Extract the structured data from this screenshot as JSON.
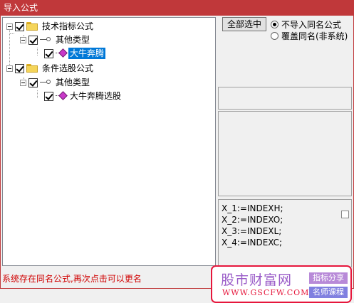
{
  "window": {
    "title": "导入公式"
  },
  "tree": {
    "nodes": [
      {
        "label": "技术指标公式"
      },
      {
        "label": "其他类型"
      },
      {
        "label": "大牛奔腾"
      },
      {
        "label": "条件选股公式"
      },
      {
        "label": "其他类型"
      },
      {
        "label": "大牛奔腾选股"
      }
    ]
  },
  "options": {
    "select_all_label": "全部选中",
    "radio_skip_label": "不导入同名公式",
    "radio_overwrite_label": "覆盖同名(非系统)",
    "selected_radio": "不导入同名公式"
  },
  "code_lines": [
    "X_1:=INDEXH;",
    "X_2:=INDEXO;",
    "X_3:=INDEXL;",
    "X_4:=INDEXC;"
  ],
  "status_text": "系统存在同名公式,再次点击可以更名",
  "watermark": {
    "title": "股市财富网",
    "url": "WWW.GSCFW.COM",
    "tag1": "指标分享",
    "tag2": "名师课程"
  }
}
